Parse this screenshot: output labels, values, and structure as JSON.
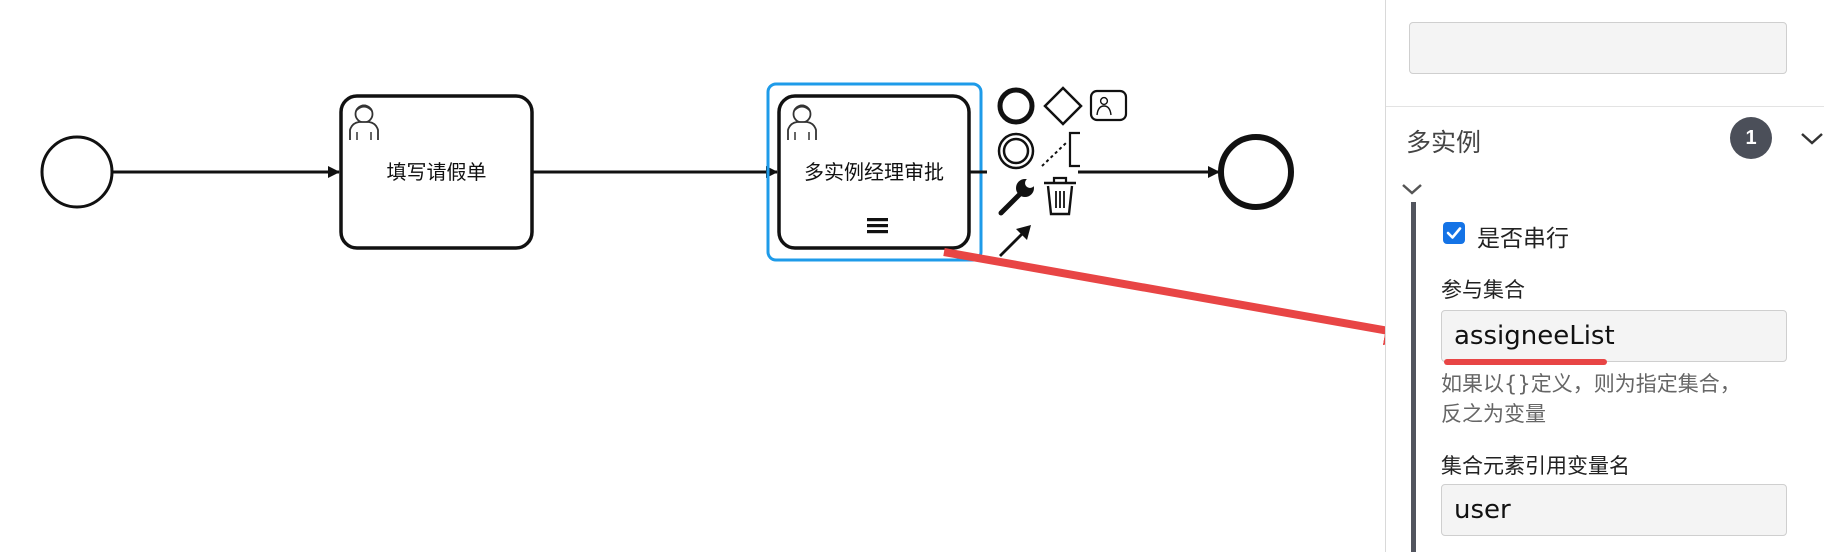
{
  "diagram": {
    "tasks": [
      {
        "id": "fill-leave-form",
        "label": "填写请假单",
        "type": "user-task"
      },
      {
        "id": "multi-instance-manager-approval",
        "label": "多实例经理审批",
        "type": "user-task",
        "multi_instance": "sequential",
        "selected": true
      }
    ],
    "events": [
      {
        "id": "start-event",
        "type": "start"
      },
      {
        "id": "end-event",
        "type": "end"
      }
    ],
    "context_pad": [
      "end-event-icon",
      "gateway-icon",
      "user-task-icon",
      "intermediate-event-icon",
      "text-annotation-icon",
      "wrench-icon",
      "delete-icon",
      "connect-arrow-icon"
    ],
    "annotation_arrow_color": "#e84545",
    "selection_color": "#1e9be9"
  },
  "panel": {
    "section_title": "多实例",
    "section_badge": "1",
    "sequential_label": "是否串行",
    "sequential_checked": true,
    "collection_label": "参与集合",
    "collection_value": "assigneeList",
    "hint_line1": "如果以{}定义，则为指定集合，",
    "hint_line2": "反之为变量",
    "element_var_label": "集合元素引用变量名",
    "element_var_value": "user",
    "top_field_value": ""
  }
}
